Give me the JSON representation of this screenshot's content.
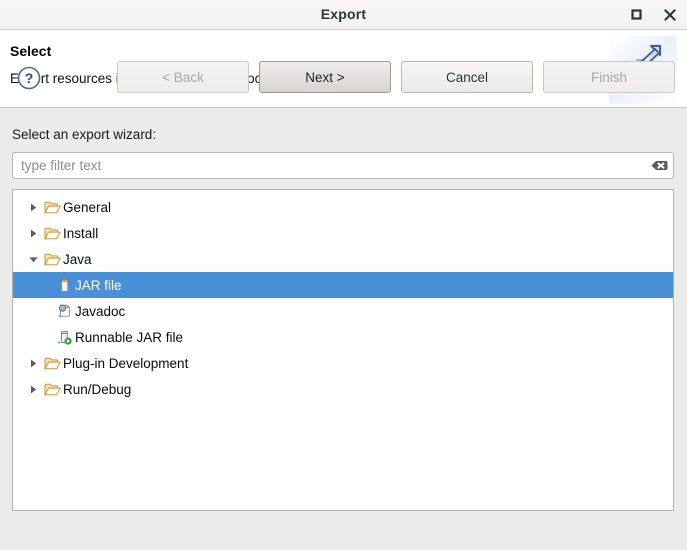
{
  "window": {
    "title": "Export",
    "maximize_icon": "maximize-icon",
    "close_icon": "close-icon"
  },
  "header": {
    "title": "Select",
    "description": "Export resources into a JAR file on the local file system.",
    "icon": "export-wizard-icon"
  },
  "main": {
    "label": "Select an export wizard:",
    "filter": {
      "value": "",
      "placeholder": "type filter text",
      "clear_icon": "clear-icon"
    },
    "tree": [
      {
        "label": "General",
        "icon": "folder-icon",
        "twisty": "collapsed",
        "level": 1,
        "selected": false
      },
      {
        "label": "Install",
        "icon": "folder-icon",
        "twisty": "collapsed",
        "level": 1,
        "selected": false
      },
      {
        "label": "Java",
        "icon": "folder-icon",
        "twisty": "expanded",
        "level": 1,
        "selected": false
      },
      {
        "label": "JAR file",
        "icon": "jar-file-icon",
        "twisty": "none",
        "level": 2,
        "selected": true
      },
      {
        "label": "Javadoc",
        "icon": "javadoc-icon",
        "twisty": "none",
        "level": 2,
        "selected": false
      },
      {
        "label": "Runnable JAR file",
        "icon": "runnable-jar-icon",
        "twisty": "none",
        "level": 2,
        "selected": false
      },
      {
        "label": "Plug-in Development",
        "icon": "folder-icon",
        "twisty": "collapsed",
        "level": 1,
        "selected": false
      },
      {
        "label": "Run/Debug",
        "icon": "folder-icon",
        "twisty": "collapsed",
        "level": 1,
        "selected": false
      }
    ]
  },
  "footer": {
    "help_icon": "help-icon",
    "buttons": [
      {
        "label": "< Back",
        "state": "disabled"
      },
      {
        "label": "Next >",
        "state": "default"
      },
      {
        "label": "Cancel",
        "state": "normal"
      },
      {
        "label": "Finish",
        "state": "disabled"
      }
    ]
  },
  "colors": {
    "selection": "#4a90d9",
    "dialog_background": "#ebebe9",
    "header_background": "#ffffff",
    "folder_icon": "#e8a33d"
  }
}
